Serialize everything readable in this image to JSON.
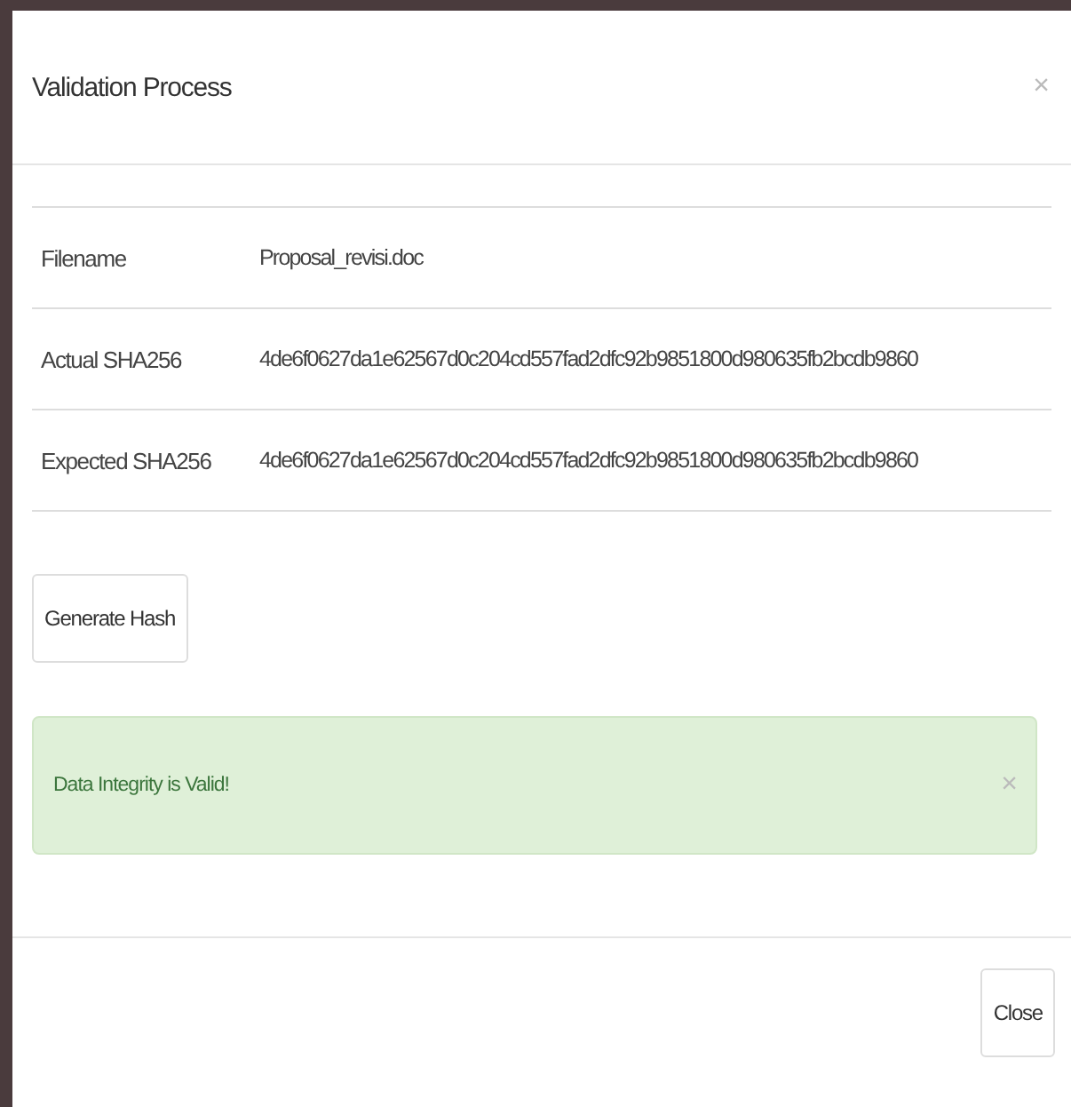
{
  "modal": {
    "title": "Validation Process",
    "close_icon": "×"
  },
  "details": [
    {
      "label": "Filename",
      "value": "Proposal_revisi.doc"
    },
    {
      "label": "Actual SHA256",
      "value": "4de6f0627da1e62567d0c204cd557fad2dfc92b9851800d980635fb2bcdb9860"
    },
    {
      "label": "Expected SHA256",
      "value": "4de6f0627da1e62567d0c204cd557fad2dfc92b9851800d980635fb2bcdb9860"
    }
  ],
  "generate_button": "Generate Hash",
  "alert": {
    "kind": "success",
    "message": "Data Integrity is Valid!",
    "close_icon": "×"
  },
  "footer_button": "Close"
}
